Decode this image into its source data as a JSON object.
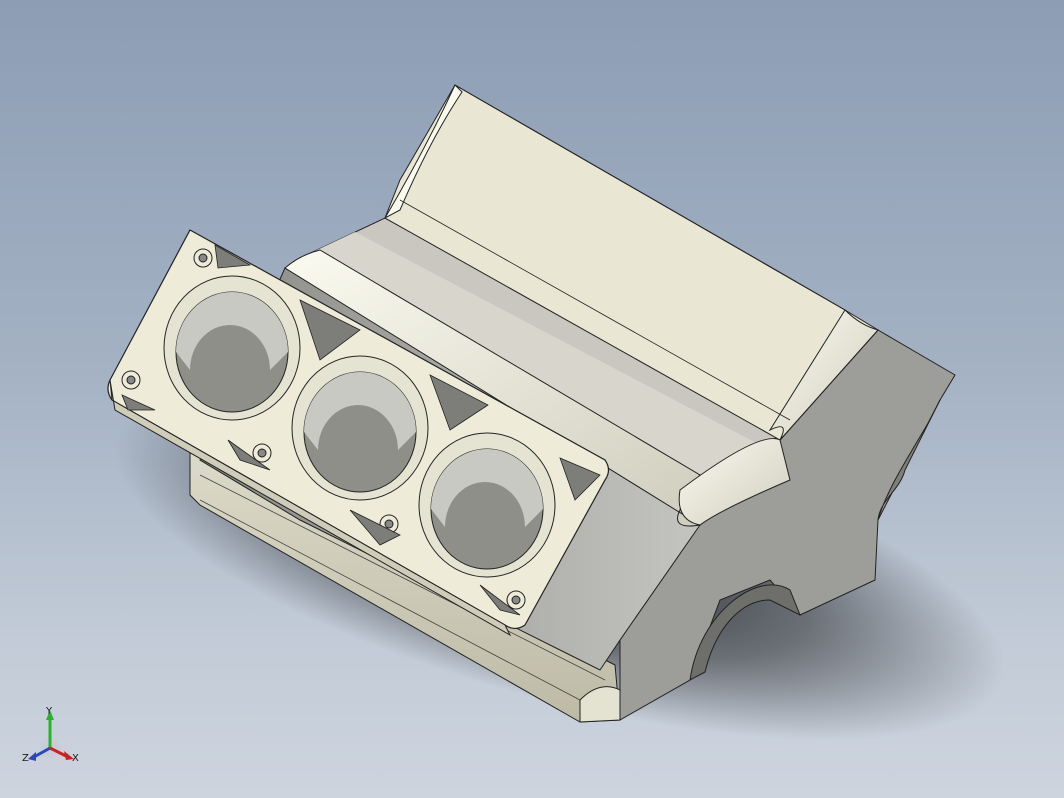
{
  "view": {
    "background_top": "#8d9db4",
    "background_bottom": "#cdd4de",
    "model": "engine-block",
    "model_face_color": "#e6e4d2",
    "model_shade_color": "#c8c6bd"
  },
  "triad": {
    "x_label": "X",
    "y_label": "Y",
    "z_label": "Z",
    "x_color": "#d21e1e",
    "y_color": "#28b428",
    "z_color": "#2846c8"
  }
}
